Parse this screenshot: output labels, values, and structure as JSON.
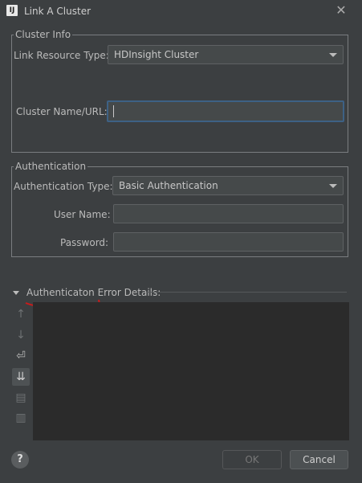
{
  "window": {
    "title": "Link A Cluster",
    "app_icon_text": "IJ"
  },
  "cluster_info": {
    "legend": "Cluster Info",
    "resource_type_label": "Link Resource Type:",
    "resource_type_value": "HDInsight Cluster",
    "cluster_name_label": "Cluster Name/URL:",
    "cluster_name_value": ""
  },
  "authentication": {
    "legend": "Authentication",
    "type_label": "Authentication Type:",
    "type_value": "Basic Authentication",
    "username_label": "User Name:",
    "username_value": "",
    "password_label": "Password:",
    "password_value": ""
  },
  "error_details": {
    "title": "Authenticaton Error Details:",
    "expanded": true,
    "annotation_color": "#cc1a1a"
  },
  "toolbar_icons": [
    "arrow-up-icon",
    "arrow-down-icon",
    "soft-wrap-icon",
    "scroll-to-end-icon",
    "print-icon",
    "trash-icon"
  ],
  "buttons": {
    "help": "?",
    "ok": "OK",
    "cancel": "Cancel"
  }
}
